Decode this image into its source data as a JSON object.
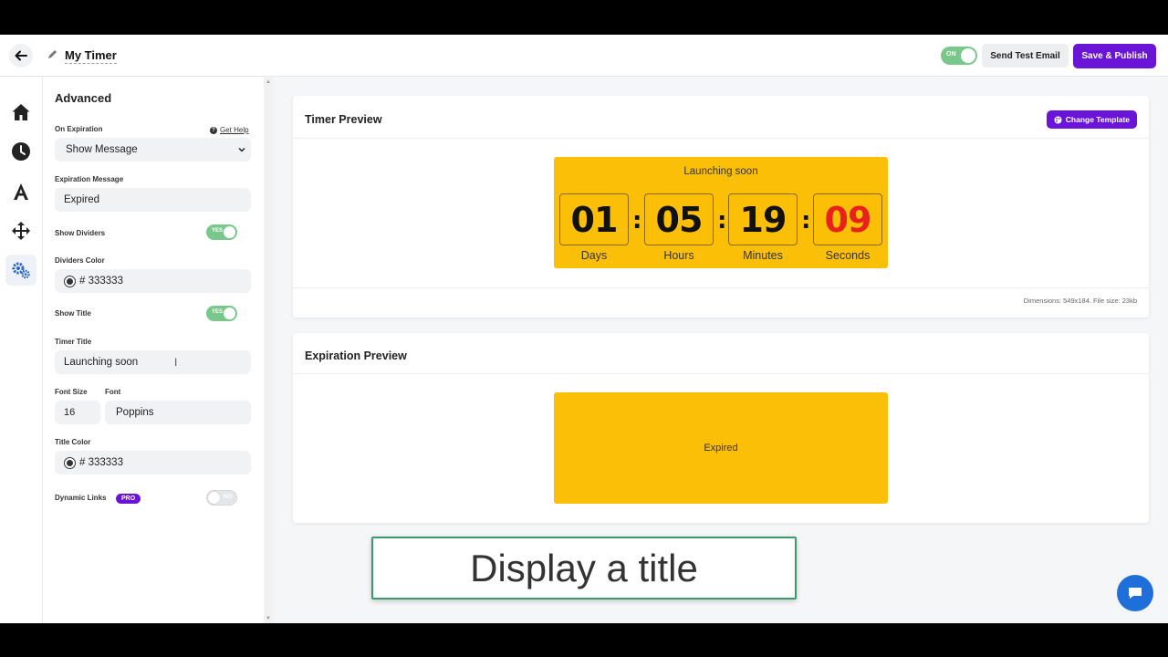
{
  "topbar": {
    "timer_name": "My Timer",
    "live_toggle": "ON",
    "send_test_label": "Send Test Email",
    "publish_label": "Save & Publish"
  },
  "rail": {
    "icons": [
      "home-icon",
      "clock-icon",
      "font-icon",
      "move-icon",
      "gears-icon"
    ],
    "active": "gears-icon"
  },
  "panel": {
    "title": "Advanced",
    "on_expiration_label": "On Expiration",
    "get_help": "Get Help",
    "on_expiration_value": "Show Message",
    "expiration_message_label": "Expiration Message",
    "expiration_message_value": "Expired",
    "show_dividers_label": "Show Dividers",
    "show_dividers_toggle": "YES",
    "dividers_color_label": "Dividers Color",
    "dividers_color_value": "# 333333",
    "show_title_label": "Show Title",
    "show_title_toggle": "YES",
    "timer_title_label": "Timer Title",
    "timer_title_value": "Launching soon",
    "font_size_label": "Font Size",
    "font_size_value": "16",
    "font_label": "Font",
    "font_value": "Poppins",
    "title_color_label": "Title Color",
    "title_color_value": "# 333333",
    "dynamic_links_label": "Dynamic Links",
    "pro_badge": "PRO",
    "dynamic_links_toggle": "NO"
  },
  "timer_preview": {
    "title": "Timer Preview",
    "change_template": "Change Template",
    "timer_title": "Launching soon",
    "units": [
      {
        "value": "01",
        "label": "Days"
      },
      {
        "value": "05",
        "label": "Hours"
      },
      {
        "value": "19",
        "label": "Minutes"
      },
      {
        "value": "09",
        "label": "Seconds"
      }
    ],
    "dimensions": "Dimensions: 549x184. File size: 23kb"
  },
  "expiration_preview": {
    "title": "Expiration Preview",
    "message": "Expired"
  },
  "caption": "Display a title",
  "colors": {
    "accent": "#6a14d8",
    "timer_bg": "#fcbf07",
    "seconds": "#e8211a",
    "toggle_on": "#7ac78c"
  }
}
